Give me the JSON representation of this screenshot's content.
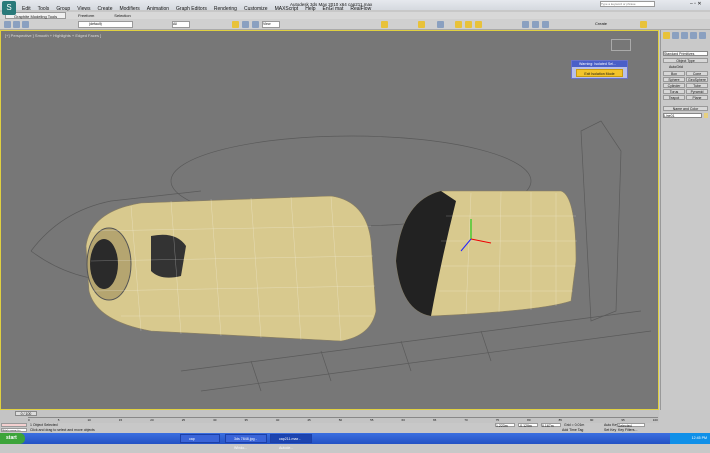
{
  "title": "Autodesk 3ds Max 2010 x64    cap211.max",
  "search_placeholder": "Type a keyword or phrase",
  "menu": [
    "Edit",
    "Tools",
    "Group",
    "Views",
    "Create",
    "Modifiers",
    "Animation",
    "Graph Editors",
    "Rendering",
    "Customize",
    "MAXScript",
    "Help",
    "EnGi mat",
    "RealFlow"
  ],
  "ribbon_tabs": [
    "Graphite Modeling Tools",
    "Freeform",
    "Selection"
  ],
  "toolbar": {
    "selection_set": "(default)",
    "view_dropdown": "All",
    "coord_dropdown": "View",
    "create_selection": "Create"
  },
  "viewport": {
    "label": "[+] Perspective ] Smooth + Highlights + Edged Faces ]"
  },
  "warning": {
    "title": "Warning: Isolated Sel...",
    "button": "Exit Isolation Mode"
  },
  "command_panel": {
    "category": "Standard Primitives",
    "object_type": "Object Type",
    "autogrid": "AutoGrid",
    "buttons": [
      "Box",
      "Cone",
      "Sphere",
      "GeoSphere",
      "Cylinder",
      "Tube",
      "Torus",
      "Pyramid",
      "Teapot",
      "Plane"
    ],
    "name_color": "Name and Color",
    "name_value": "Line01"
  },
  "timeline": {
    "frame": "0 / 100",
    "ticks": [
      "0",
      "5",
      "10",
      "15",
      "20",
      "25",
      "30",
      "35",
      "40",
      "45",
      "50",
      "55",
      "60",
      "65",
      "70",
      "75",
      "80",
      "85",
      "90",
      "95",
      "100"
    ]
  },
  "status": {
    "selected": "1 Object Selected",
    "prompt": "Click and drag to select and move objects",
    "welcome": "Welcome to M...",
    "x": "1.223m",
    "y": "-0.129m",
    "z": "0.167m",
    "grid": "Grid = 0.01m",
    "add_time_tag": "Add Time Tag",
    "auto_key": "Auto Key",
    "selected_dropdown": "Selected",
    "set_key": "Set Key",
    "key_filters": "Key Filters..."
  },
  "taskbar": {
    "start": "start",
    "tasks": [
      "cap",
      "3ds 7848.jpg - Windo...",
      "cap211.max - Autode..."
    ],
    "clock": "12:45 PM"
  }
}
